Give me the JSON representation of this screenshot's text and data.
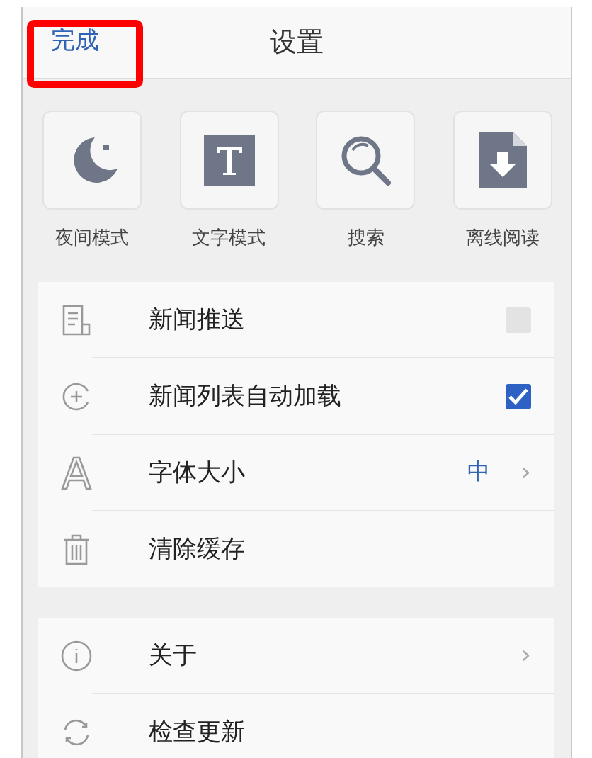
{
  "header": {
    "done": "完成",
    "title": "设置",
    "done_highlighted": true
  },
  "shortcuts": [
    {
      "label": "夜间模式"
    },
    {
      "label": "文字模式"
    },
    {
      "label": "搜索"
    },
    {
      "label": "离线阅读"
    }
  ],
  "groups": [
    [
      {
        "label": "新闻推送",
        "kind": "checkbox",
        "checked": false
      },
      {
        "label": "新闻列表自动加载",
        "kind": "checkbox",
        "checked": true
      },
      {
        "label": "字体大小",
        "kind": "value",
        "value": "中",
        "chevron": "›"
      },
      {
        "label": "清除缓存",
        "kind": "plain"
      }
    ],
    [
      {
        "label": "关于",
        "kind": "value",
        "chevron": "›"
      },
      {
        "label": "检查更新",
        "kind": "plain"
      }
    ]
  ]
}
